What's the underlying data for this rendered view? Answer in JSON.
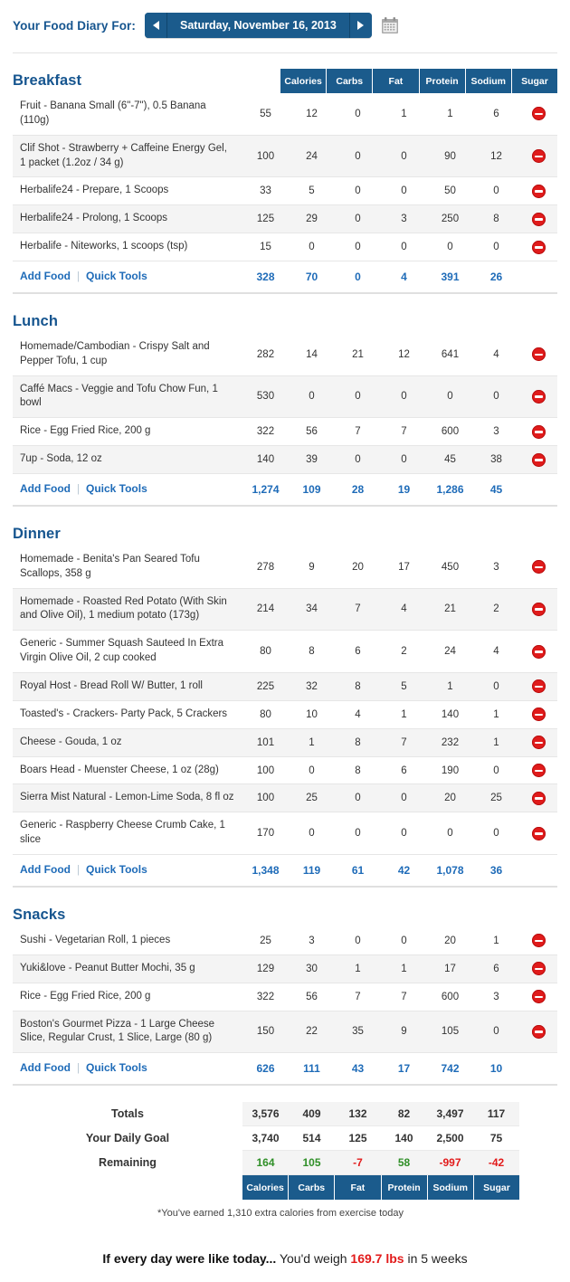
{
  "header": {
    "label": "Your Food Diary For:",
    "date": "Saturday, November 16, 2013",
    "prev_icon": "chevron-left-icon",
    "next_icon": "chevron-right-icon",
    "calendar_icon": "calendar-icon"
  },
  "columns": [
    "Calories",
    "Carbs",
    "Fat",
    "Protein",
    "Sodium",
    "Sugar"
  ],
  "links": {
    "add_food": "Add Food",
    "quick_tools": "Quick Tools",
    "separator": "|"
  },
  "meals": [
    {
      "title": "Breakfast",
      "show_column_header": true,
      "rows": [
        {
          "food": "Fruit - Banana Small (6\"-7\"), 0.5 Banana (110g)",
          "values": [
            "55",
            "12",
            "0",
            "1",
            "1",
            "6"
          ]
        },
        {
          "food": "Clif Shot - Strawberry + Caffeine Energy Gel, 1 packet (1.2oz / 34 g)",
          "values": [
            "100",
            "24",
            "0",
            "0",
            "90",
            "12"
          ]
        },
        {
          "food": "Herbalife24 - Prepare, 1 Scoops",
          "values": [
            "33",
            "5",
            "0",
            "0",
            "50",
            "0"
          ]
        },
        {
          "food": "Herbalife24 - Prolong, 1 Scoops",
          "values": [
            "125",
            "29",
            "0",
            "3",
            "250",
            "8"
          ]
        },
        {
          "food": "Herbalife - Niteworks, 1 scoops (tsp)",
          "values": [
            "15",
            "0",
            "0",
            "0",
            "0",
            "0"
          ]
        }
      ],
      "totals": [
        "328",
        "70",
        "0",
        "4",
        "391",
        "26"
      ]
    },
    {
      "title": "Lunch",
      "show_column_header": false,
      "rows": [
        {
          "food": "Homemade/Cambodian - Crispy Salt and Pepper Tofu, 1 cup",
          "values": [
            "282",
            "14",
            "21",
            "12",
            "641",
            "4"
          ]
        },
        {
          "food": "Caffé Macs - Veggie and Tofu Chow Fun, 1 bowl",
          "values": [
            "530",
            "0",
            "0",
            "0",
            "0",
            "0"
          ]
        },
        {
          "food": "Rice - Egg Fried Rice, 200 g",
          "values": [
            "322",
            "56",
            "7",
            "7",
            "600",
            "3"
          ]
        },
        {
          "food": "7up - Soda, 12 oz",
          "values": [
            "140",
            "39",
            "0",
            "0",
            "45",
            "38"
          ]
        }
      ],
      "totals": [
        "1,274",
        "109",
        "28",
        "19",
        "1,286",
        "45"
      ]
    },
    {
      "title": "Dinner",
      "show_column_header": false,
      "rows": [
        {
          "food": "Homemade - Benita's Pan Seared Tofu Scallops, 358 g",
          "values": [
            "278",
            "9",
            "20",
            "17",
            "450",
            "3"
          ]
        },
        {
          "food": "Homemade - Roasted Red Potato (With Skin and Olive Oil), 1 medium potato (173g)",
          "values": [
            "214",
            "34",
            "7",
            "4",
            "21",
            "2"
          ]
        },
        {
          "food": "Generic - Summer Squash Sauteed In Extra Virgin Olive Oil, 2 cup cooked",
          "values": [
            "80",
            "8",
            "6",
            "2",
            "24",
            "4"
          ]
        },
        {
          "food": "Royal Host - Bread Roll W/ Butter, 1 roll",
          "values": [
            "225",
            "32",
            "8",
            "5",
            "1",
            "0"
          ]
        },
        {
          "food": "Toasted's - Crackers- Party Pack, 5 Crackers",
          "values": [
            "80",
            "10",
            "4",
            "1",
            "140",
            "1"
          ]
        },
        {
          "food": "Cheese - Gouda, 1 oz",
          "values": [
            "101",
            "1",
            "8",
            "7",
            "232",
            "1"
          ]
        },
        {
          "food": "Boars Head - Muenster Cheese, 1 oz (28g)",
          "values": [
            "100",
            "0",
            "8",
            "6",
            "190",
            "0"
          ]
        },
        {
          "food": "Sierra Mist Natural - Lemon-Lime Soda, 8 fl oz",
          "values": [
            "100",
            "25",
            "0",
            "0",
            "20",
            "25"
          ]
        },
        {
          "food": "Generic - Raspberry Cheese Crumb Cake, 1 slice",
          "values": [
            "170",
            "0",
            "0",
            "0",
            "0",
            "0"
          ]
        }
      ],
      "totals": [
        "1,348",
        "119",
        "61",
        "42",
        "1,078",
        "36"
      ]
    },
    {
      "title": "Snacks",
      "show_column_header": false,
      "rows": [
        {
          "food": "Sushi - Vegetarian Roll, 1 pieces",
          "values": [
            "25",
            "3",
            "0",
            "0",
            "20",
            "1"
          ]
        },
        {
          "food": "Yuki&love - Peanut Butter Mochi, 35 g",
          "values": [
            "129",
            "30",
            "1",
            "1",
            "17",
            "6"
          ]
        },
        {
          "food": "Rice - Egg Fried Rice, 200 g",
          "values": [
            "322",
            "56",
            "7",
            "7",
            "600",
            "3"
          ]
        },
        {
          "food": "Boston's Gourmet Pizza - 1 Large Cheese Slice, Regular Crust, 1 Slice, Large (80 g)",
          "values": [
            "150",
            "22",
            "35",
            "9",
            "105",
            "0"
          ]
        }
      ],
      "totals": [
        "626",
        "111",
        "43",
        "17",
        "742",
        "10"
      ]
    }
  ],
  "summary_table": {
    "rows": [
      {
        "label": "Totals",
        "values": [
          "3,576",
          "409",
          "132",
          "82",
          "3,497",
          "117"
        ],
        "signs": [
          "",
          "",
          "",
          "",
          "",
          ""
        ]
      },
      {
        "label": "Your Daily Goal",
        "values": [
          "3,740",
          "514",
          "125",
          "140",
          "2,500",
          "75"
        ],
        "signs": [
          "",
          "",
          "",
          "",
          "",
          ""
        ]
      },
      {
        "label": "Remaining",
        "values": [
          "164",
          "105",
          "-7",
          "58",
          "-997",
          "-42"
        ],
        "signs": [
          "pos",
          "pos",
          "neg",
          "pos",
          "neg",
          "neg"
        ]
      }
    ]
  },
  "exercise_note": "*You've earned 1,310 extra calories from exercise today",
  "footer": {
    "lead": "If every day were like today...",
    "middle": "You'd weigh",
    "weight": "169.7 lbs",
    "tail": "in 5 weeks"
  },
  "colors": {
    "brand_blue": "#1b5b8c",
    "link_blue": "#1e6bb8",
    "positive_green": "#2f8f27",
    "negative_red": "#e21b1b",
    "delete_red": "#e01b1b"
  }
}
